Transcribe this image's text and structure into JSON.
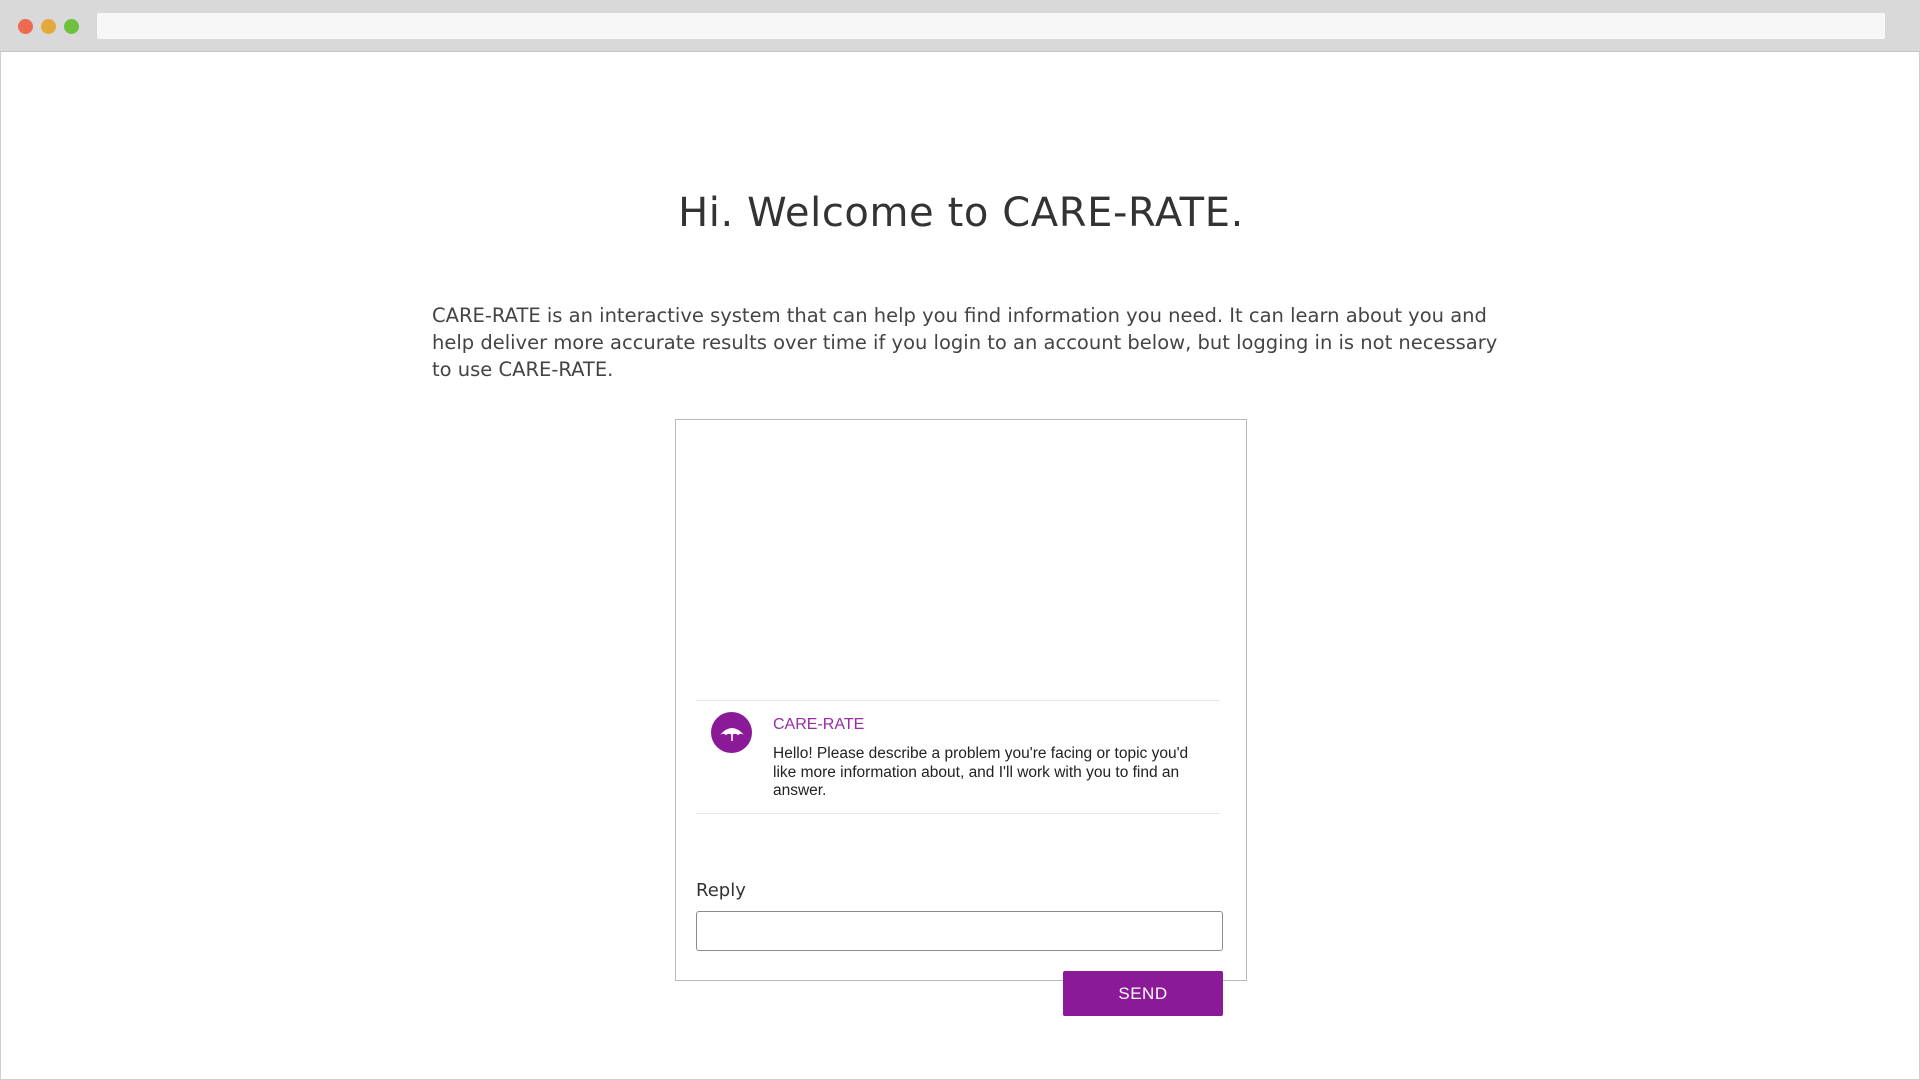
{
  "page": {
    "title": "Hi. Welcome to CARE-RATE.",
    "intro": "CARE-RATE is an interactive system that can help you find information you need. It can learn about you and help deliver more accurate results over time if you login to an account below, but logging in is not necessary to use CARE-RATE."
  },
  "chat": {
    "messages": [
      {
        "sender": "CARE-RATE",
        "avatar_icon": "umbrella-icon",
        "text": "Hello! Please describe a problem you're facing or topic you'd like more information about, and I'll work with you to find an answer."
      }
    ],
    "reply_label": "Reply",
    "reply_value": "",
    "send_label": "SEND"
  },
  "colors": {
    "accent": "#8a1a98",
    "sender_text": "#9a2aa8"
  }
}
